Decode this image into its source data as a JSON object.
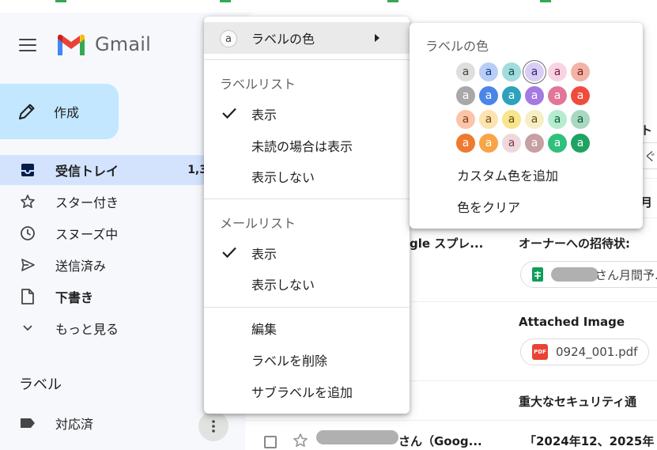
{
  "sidebar": {
    "logo_text": "Gmail",
    "compose_label": "作成",
    "nav": [
      {
        "label": "受信トレイ",
        "icon": "inbox-icon",
        "count": "1,3",
        "active": true
      },
      {
        "label": "スター付き",
        "icon": "star-icon"
      },
      {
        "label": "スヌーズ中",
        "icon": "clock-icon"
      },
      {
        "label": "送信済み",
        "icon": "send-icon"
      },
      {
        "label": "下書き",
        "icon": "draft-icon",
        "bold": true
      },
      {
        "label": "もっと見る",
        "icon": "chevron-down-icon"
      }
    ],
    "labels_title": "ラベル",
    "labels": [
      {
        "label": "対応済",
        "icon": "label-tag-icon"
      }
    ]
  },
  "context_menu": {
    "label_color": "ラベルの色",
    "label_list_title": "ラベルリスト",
    "label_list": [
      {
        "label": "表示",
        "checked": true
      },
      {
        "label": "未読の場合は表示",
        "checked": false
      },
      {
        "label": "表示しない",
        "checked": false
      }
    ],
    "mail_list_title": "メールリスト",
    "mail_list": [
      {
        "label": "表示",
        "checked": true
      },
      {
        "label": "表示しない",
        "checked": false
      }
    ],
    "actions": [
      "編集",
      "ラベルを削除",
      "サブラベルを追加"
    ]
  },
  "color_submenu": {
    "title": "ラベルの色",
    "swatch_letter": "a",
    "swatches": [
      {
        "bg": "#dedede",
        "fg": "#444444"
      },
      {
        "bg": "#b8cef5",
        "fg": "#0b3d91"
      },
      {
        "bg": "#a2dcdc",
        "fg": "#0b4f4f"
      },
      {
        "bg": "#d8cdf3",
        "fg": "#41236d",
        "selected": true
      },
      {
        "bg": "#f8d4e3",
        "fg": "#7a1e46"
      },
      {
        "bg": "#f2b3a8",
        "fg": "#7a1e10"
      },
      {
        "bg": "#a8a8a8",
        "fg": "#ffffff"
      },
      {
        "bg": "#4a86e8",
        "fg": "#ffffff"
      },
      {
        "bg": "#2da2bb",
        "fg": "#ffffff"
      },
      {
        "bg": "#a479e2",
        "fg": "#ffffff"
      },
      {
        "bg": "#e07798",
        "fg": "#ffffff"
      },
      {
        "bg": "#f04c3e",
        "fg": "#ffffff"
      },
      {
        "bg": "#fcc4a8",
        "fg": "#7a3e1e"
      },
      {
        "bg": "#fce3b0",
        "fg": "#6b4e12"
      },
      {
        "bg": "#f8e58c",
        "fg": "#5c5010"
      },
      {
        "bg": "#f6efc5",
        "fg": "#5c5010"
      },
      {
        "bg": "#b4ecd0",
        "fg": "#0b5a36"
      },
      {
        "bg": "#a8d8c0",
        "fg": "#0b5a36"
      },
      {
        "bg": "#ee7a2f",
        "fg": "#ffffff"
      },
      {
        "bg": "#f7a546",
        "fg": "#ffffff"
      },
      {
        "bg": "#efd8dc",
        "fg": "#7a3e46"
      },
      {
        "bg": "#c7a0a4",
        "fg": "#ffffff"
      },
      {
        "bg": "#2fc07b",
        "fg": "#ffffff"
      },
      {
        "bg": "#1ea362",
        "fg": "#ffffff"
      }
    ],
    "add_custom": "カスタム色を追加",
    "clear": "色をクリア"
  },
  "mail_list": {
    "fragments": {
      "r1_subject_tail": "ト",
      "r1_search_tail": "ぐ...",
      "r2_subject_tail": "月",
      "r3_sender": "gle スプレ...",
      "r3_subject": "オーナーへの招待状:",
      "r3_chip": "さん月間予...",
      "r4_subject": "Attached Image",
      "r4_chip": "0924_001.pdf",
      "r5_subject": "重大なセキュリティ通",
      "r6_sender_tail": "さん（Goog...",
      "r6_subject": "「2024年12、2025年"
    },
    "pdf_badge": "PDF"
  }
}
